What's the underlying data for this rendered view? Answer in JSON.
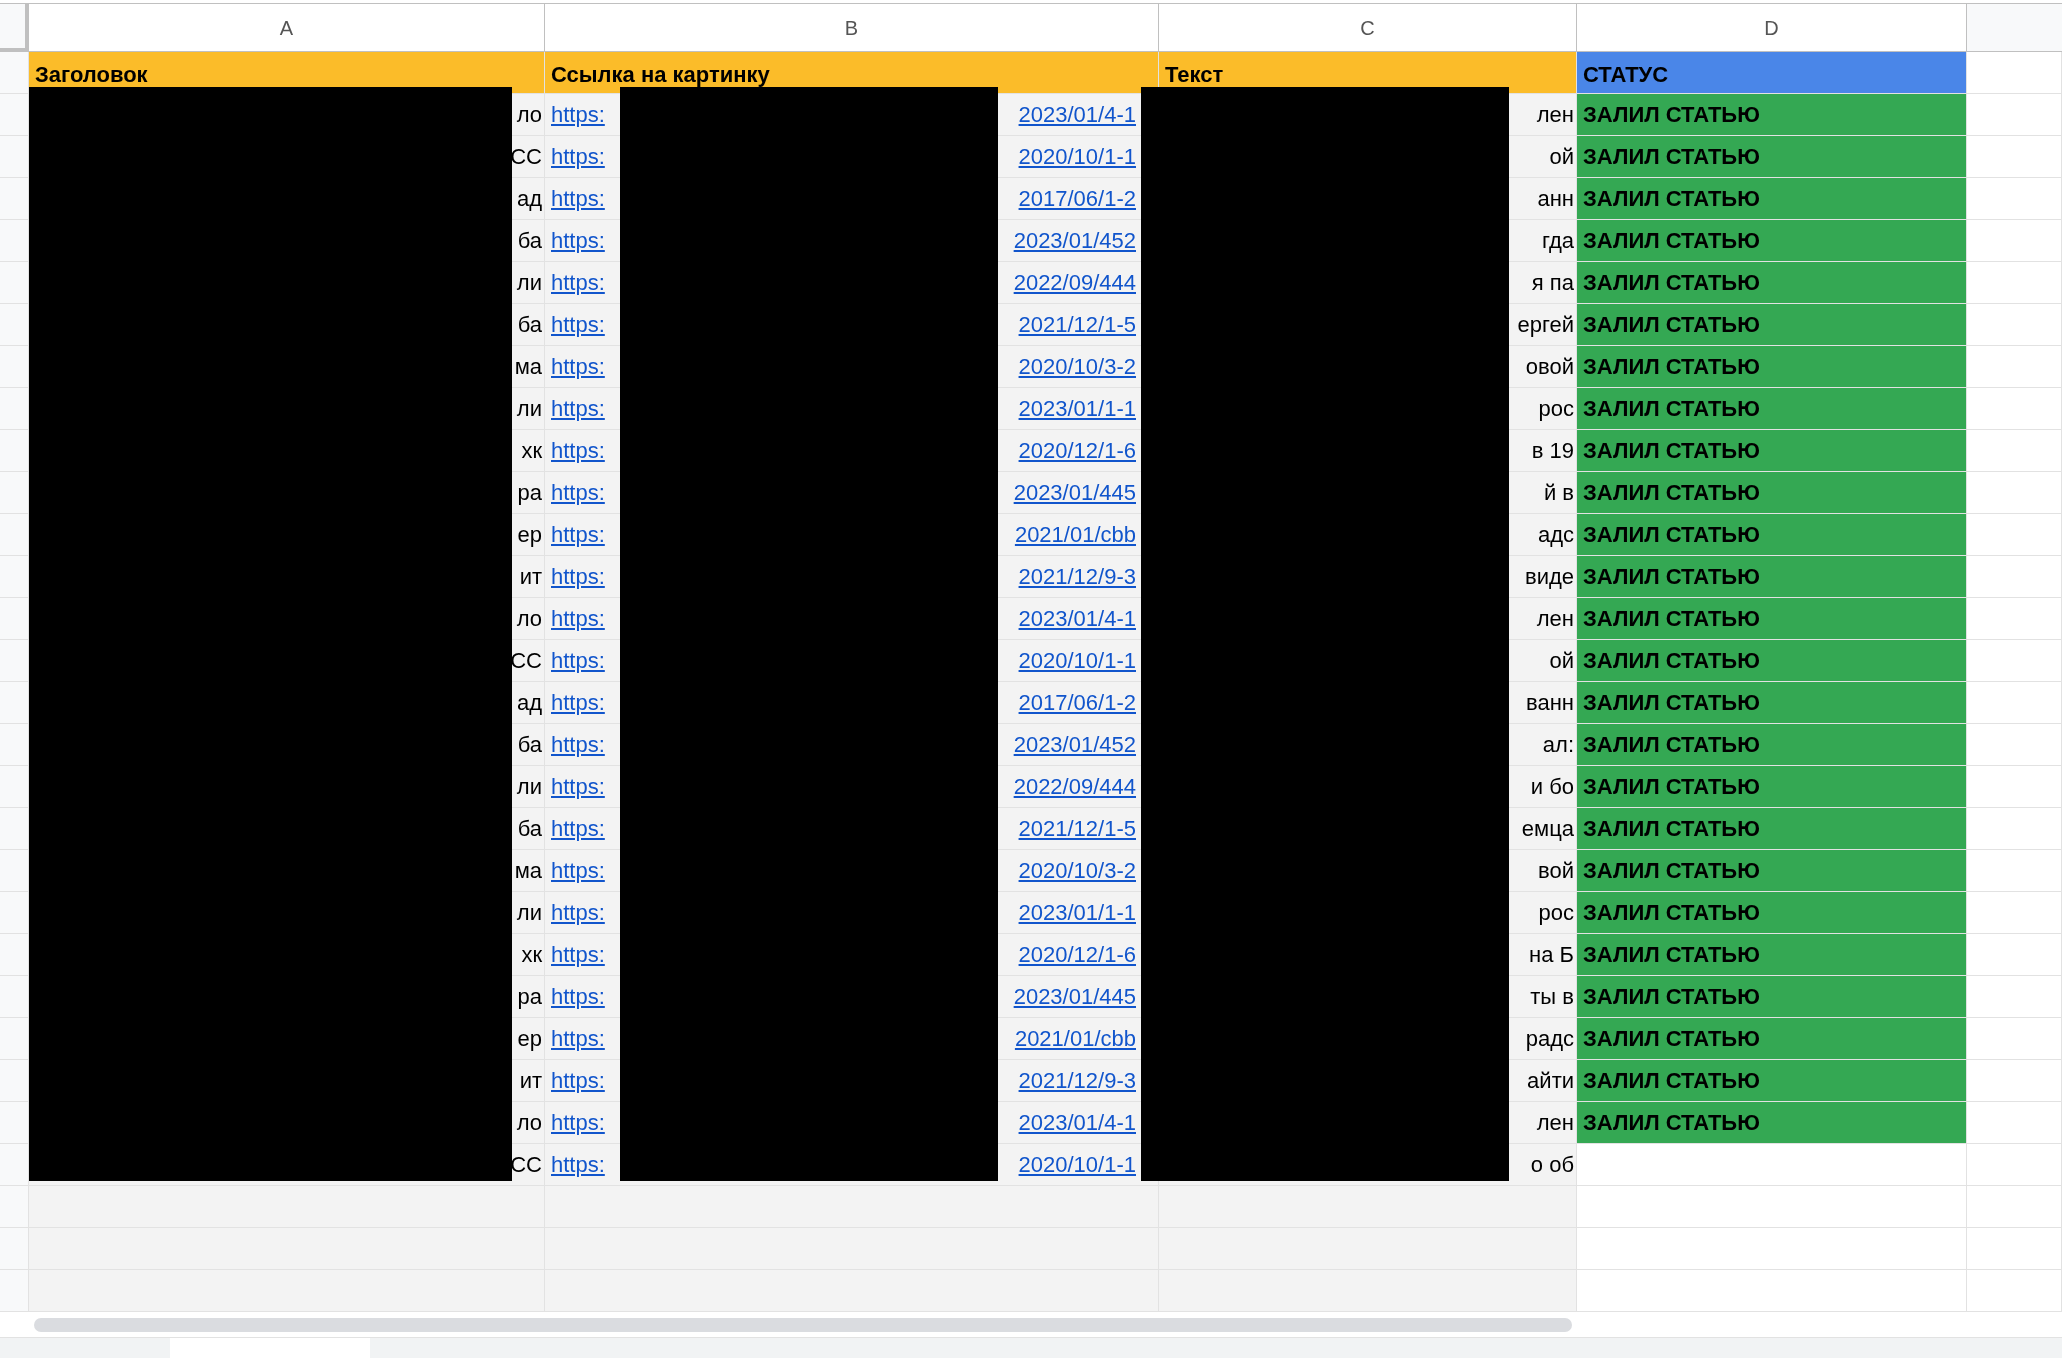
{
  "column_headers": [
    "A",
    "B",
    "C",
    "D"
  ],
  "header": {
    "title": "Заголовок",
    "image_link": "Ссылка на картинку",
    "text": "Текст",
    "status": "СТАТУС"
  },
  "rows": [
    {
      "title": "ло",
      "link_start": "https:",
      "link_end": "2023/01/4-1",
      "text": "лен",
      "status": "ЗАЛИЛ СТАТЬЮ"
    },
    {
      "title": "СС",
      "link_start": "https:",
      "link_end": "2020/10/1-1",
      "text": "ой",
      "status": "ЗАЛИЛ СТАТЬЮ"
    },
    {
      "title": "ад",
      "link_start": "https:",
      "link_end": "2017/06/1-2",
      "text": "анн",
      "status": "ЗАЛИЛ СТАТЬЮ"
    },
    {
      "title": "ба",
      "link_start": "https:",
      "link_end": "2023/01/452",
      "text": "гда",
      "status": "ЗАЛИЛ СТАТЬЮ"
    },
    {
      "title": "ли",
      "link_start": "https:",
      "link_end": "2022/09/444",
      "text": "я па",
      "status": "ЗАЛИЛ СТАТЬЮ"
    },
    {
      "title": "ба",
      "link_start": "https:",
      "link_end": "2021/12/1-5",
      "text": "ергей",
      "status": "ЗАЛИЛ СТАТЬЮ"
    },
    {
      "title": "ма",
      "link_start": "https:",
      "link_end": "2020/10/3-2",
      "text": "овой",
      "status": "ЗАЛИЛ СТАТЬЮ"
    },
    {
      "title": "ли",
      "link_start": "https:",
      "link_end": "2023/01/1-1",
      "text": "рос",
      "status": "ЗАЛИЛ СТАТЬЮ"
    },
    {
      "title": "хк",
      "link_start": "https:",
      "link_end": "2020/12/1-6",
      "text": "в 19",
      "status": "ЗАЛИЛ СТАТЬЮ"
    },
    {
      "title": "ра",
      "link_start": "https:",
      "link_end": "2023/01/445",
      "text": "й в",
      "status": "ЗАЛИЛ СТАТЬЮ"
    },
    {
      "title": "ер",
      "link_start": "https:",
      "link_end": "2021/01/cbb",
      "text": "адс",
      "status": "ЗАЛИЛ СТАТЬЮ"
    },
    {
      "title": "ит",
      "link_start": "https:",
      "link_end": "2021/12/9-3",
      "text": "виде",
      "status": "ЗАЛИЛ СТАТЬЮ"
    },
    {
      "title": "ло",
      "link_start": "https:",
      "link_end": "2023/01/4-1",
      "text": "лен",
      "status": "ЗАЛИЛ СТАТЬЮ"
    },
    {
      "title": "СС",
      "link_start": "https:",
      "link_end": "2020/10/1-1",
      "text": "ой",
      "status": "ЗАЛИЛ СТАТЬЮ"
    },
    {
      "title": "ад",
      "link_start": "https:",
      "link_end": "2017/06/1-2",
      "text": "ванн",
      "status": "ЗАЛИЛ СТАТЬЮ"
    },
    {
      "title": "ба",
      "link_start": "https:",
      "link_end": "2023/01/452",
      "text": "ал:",
      "status": "ЗАЛИЛ СТАТЬЮ"
    },
    {
      "title": "ли",
      "link_start": "https:",
      "link_end": "2022/09/444",
      "text": "и бо",
      "status": "ЗАЛИЛ СТАТЬЮ"
    },
    {
      "title": "ба",
      "link_start": "https:",
      "link_end": "2021/12/1-5",
      "text": "емца",
      "status": "ЗАЛИЛ СТАТЬЮ"
    },
    {
      "title": "ма",
      "link_start": "https:",
      "link_end": "2020/10/3-2",
      "text": "вой",
      "status": "ЗАЛИЛ СТАТЬЮ"
    },
    {
      "title": "ли",
      "link_start": "https:",
      "link_end": "2023/01/1-1",
      "text": "рос",
      "status": "ЗАЛИЛ СТАТЬЮ"
    },
    {
      "title": "хк",
      "link_start": "https:",
      "link_end": "2020/12/1-6",
      "text": "на Б",
      "status": "ЗАЛИЛ СТАТЬЮ"
    },
    {
      "title": "ра",
      "link_start": "https:",
      "link_end": "2023/01/445",
      "text": "ты в",
      "status": "ЗАЛИЛ СТАТЬЮ"
    },
    {
      "title": "ер",
      "link_start": "https:",
      "link_end": "2021/01/cbb",
      "text": "радс",
      "status": "ЗАЛИЛ СТАТЬЮ"
    },
    {
      "title": "ит",
      "link_start": "https:",
      "link_end": "2021/12/9-3",
      "text": "айти",
      "status": "ЗАЛИЛ СТАТЬЮ"
    },
    {
      "title": "ло",
      "link_start": "https:",
      "link_end": "2023/01/4-1",
      "text": "лен",
      "status": "ЗАЛИЛ СТАТЬЮ"
    },
    {
      "title": "СС",
      "link_start": "https:",
      "link_end": "2020/10/1-1",
      "text": "о об"
    }
  ]
}
